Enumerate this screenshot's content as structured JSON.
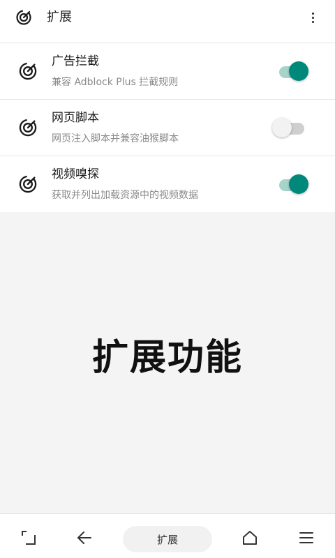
{
  "header": {
    "title": "扩展",
    "more_icon": "more-vertical-icon"
  },
  "extensions": [
    {
      "name": "广告拦截",
      "description": "兼容 Adblock Plus 拦截规则",
      "enabled": true
    },
    {
      "name": "网页脚本",
      "description": "网页注入脚本并兼容油猴脚本",
      "enabled": false
    },
    {
      "name": "视频嗅探",
      "description": "获取并列出加载资源中的视频数据",
      "enabled": true
    }
  ],
  "feature": {
    "title": "扩展功能"
  },
  "bottom_bar": {
    "center_label": "扩展",
    "icons": [
      "tabs-icon",
      "back-arrow-icon",
      "home-icon",
      "menu-icon"
    ]
  },
  "colors": {
    "accent": "#00897b",
    "accent_track": "#a6d4cb",
    "off_track": "#cfcfcf",
    "feature_bg": "#f4f4f4"
  }
}
